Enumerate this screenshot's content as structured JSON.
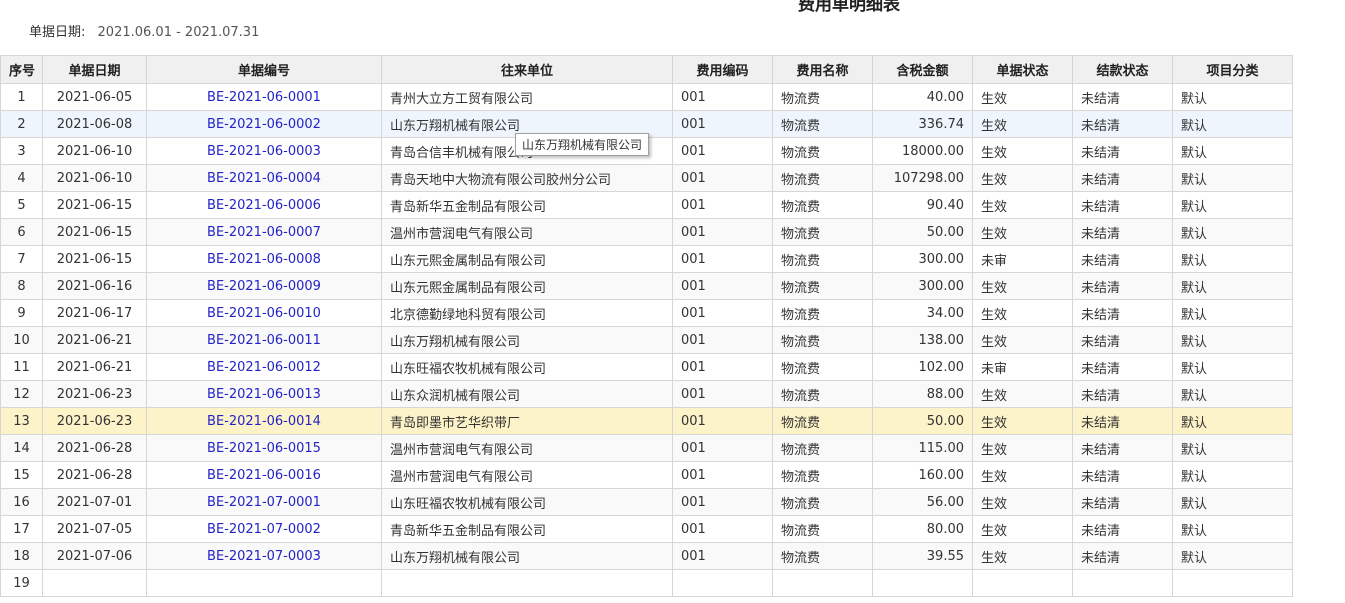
{
  "report": {
    "title": "费用单明细表",
    "date_label": "单据日期:",
    "date_range": "2021.06.01 - 2021.07.31"
  },
  "columns": [
    "序号",
    "单据日期",
    "单据编号",
    "往来单位",
    "费用编码",
    "费用名称",
    "含税金额",
    "单据状态",
    "结款状态",
    "项目分类"
  ],
  "rows": [
    {
      "seq": "1",
      "date": "2021-06-05",
      "no": "BE-2021-06-0001",
      "partner": "青州大立方工贸有限公司",
      "code": "001",
      "name": "物流费",
      "amount": "40.00",
      "status": "生效",
      "settle": "未结清",
      "category": "默认"
    },
    {
      "seq": "2",
      "date": "2021-06-08",
      "no": "BE-2021-06-0002",
      "partner": "山东万翔机械有限公司",
      "code": "001",
      "name": "物流费",
      "amount": "336.74",
      "status": "生效",
      "settle": "未结清",
      "category": "默认"
    },
    {
      "seq": "3",
      "date": "2021-06-10",
      "no": "BE-2021-06-0003",
      "partner": "青岛合信丰机械有限公司",
      "code": "001",
      "name": "物流费",
      "amount": "18000.00",
      "status": "生效",
      "settle": "未结清",
      "category": "默认"
    },
    {
      "seq": "4",
      "date": "2021-06-10",
      "no": "BE-2021-06-0004",
      "partner": "青岛天地中大物流有限公司胶州分公司",
      "code": "001",
      "name": "物流费",
      "amount": "107298.00",
      "status": "生效",
      "settle": "未结清",
      "category": "默认"
    },
    {
      "seq": "5",
      "date": "2021-06-15",
      "no": "BE-2021-06-0006",
      "partner": "青岛新华五金制品有限公司",
      "code": "001",
      "name": "物流费",
      "amount": "90.40",
      "status": "生效",
      "settle": "未结清",
      "category": "默认"
    },
    {
      "seq": "6",
      "date": "2021-06-15",
      "no": "BE-2021-06-0007",
      "partner": "温州市营润电气有限公司",
      "code": "001",
      "name": "物流费",
      "amount": "50.00",
      "status": "生效",
      "settle": "未结清",
      "category": "默认"
    },
    {
      "seq": "7",
      "date": "2021-06-15",
      "no": "BE-2021-06-0008",
      "partner": "山东元熙金属制品有限公司",
      "code": "001",
      "name": "物流费",
      "amount": "300.00",
      "status": "未审",
      "settle": "未结清",
      "category": "默认"
    },
    {
      "seq": "8",
      "date": "2021-06-16",
      "no": "BE-2021-06-0009",
      "partner": "山东元熙金属制品有限公司",
      "code": "001",
      "name": "物流费",
      "amount": "300.00",
      "status": "生效",
      "settle": "未结清",
      "category": "默认"
    },
    {
      "seq": "9",
      "date": "2021-06-17",
      "no": "BE-2021-06-0010",
      "partner": "北京德勤绿地科贸有限公司",
      "code": "001",
      "name": "物流费",
      "amount": "34.00",
      "status": "生效",
      "settle": "未结清",
      "category": "默认"
    },
    {
      "seq": "10",
      "date": "2021-06-21",
      "no": "BE-2021-06-0011",
      "partner": "山东万翔机械有限公司",
      "code": "001",
      "name": "物流费",
      "amount": "138.00",
      "status": "生效",
      "settle": "未结清",
      "category": "默认"
    },
    {
      "seq": "11",
      "date": "2021-06-21",
      "no": "BE-2021-06-0012",
      "partner": "山东旺福农牧机械有限公司",
      "code": "001",
      "name": "物流费",
      "amount": "102.00",
      "status": "未审",
      "settle": "未结清",
      "category": "默认"
    },
    {
      "seq": "12",
      "date": "2021-06-23",
      "no": "BE-2021-06-0013",
      "partner": "山东众润机械有限公司",
      "code": "001",
      "name": "物流费",
      "amount": "88.00",
      "status": "生效",
      "settle": "未结清",
      "category": "默认"
    },
    {
      "seq": "13",
      "date": "2021-06-23",
      "no": "BE-2021-06-0014",
      "partner": "青岛即墨市艺华织带厂",
      "code": "001",
      "name": "物流费",
      "amount": "50.00",
      "status": "生效",
      "settle": "未结清",
      "category": "默认"
    },
    {
      "seq": "14",
      "date": "2021-06-28",
      "no": "BE-2021-06-0015",
      "partner": "温州市营润电气有限公司",
      "code": "001",
      "name": "物流费",
      "amount": "115.00",
      "status": "生效",
      "settle": "未结清",
      "category": "默认"
    },
    {
      "seq": "15",
      "date": "2021-06-28",
      "no": "BE-2021-06-0016",
      "partner": "温州市营润电气有限公司",
      "code": "001",
      "name": "物流费",
      "amount": "160.00",
      "status": "生效",
      "settle": "未结清",
      "category": "默认"
    },
    {
      "seq": "16",
      "date": "2021-07-01",
      "no": "BE-2021-07-0001",
      "partner": "山东旺福农牧机械有限公司",
      "code": "001",
      "name": "物流费",
      "amount": "56.00",
      "status": "生效",
      "settle": "未结清",
      "category": "默认"
    },
    {
      "seq": "17",
      "date": "2021-07-05",
      "no": "BE-2021-07-0002",
      "partner": "青岛新华五金制品有限公司",
      "code": "001",
      "name": "物流费",
      "amount": "80.00",
      "status": "生效",
      "settle": "未结清",
      "category": "默认"
    },
    {
      "seq": "18",
      "date": "2021-07-06",
      "no": "BE-2021-07-0003",
      "partner": "山东万翔机械有限公司",
      "code": "001",
      "name": "物流费",
      "amount": "39.55",
      "status": "生效",
      "settle": "未结清",
      "category": "默认"
    },
    {
      "seq": "19",
      "date": "",
      "no": "",
      "partner": "",
      "code": "",
      "name": "",
      "amount": "",
      "status": "",
      "settle": "",
      "category": ""
    }
  ],
  "tooltip": {
    "text": "山东万翔机械有限公司"
  },
  "colors": {
    "link": "#2323c8",
    "header_bg": "#f0f0f0",
    "hover_row": "#eef5fd",
    "selected_row": "#fdf3c8"
  }
}
